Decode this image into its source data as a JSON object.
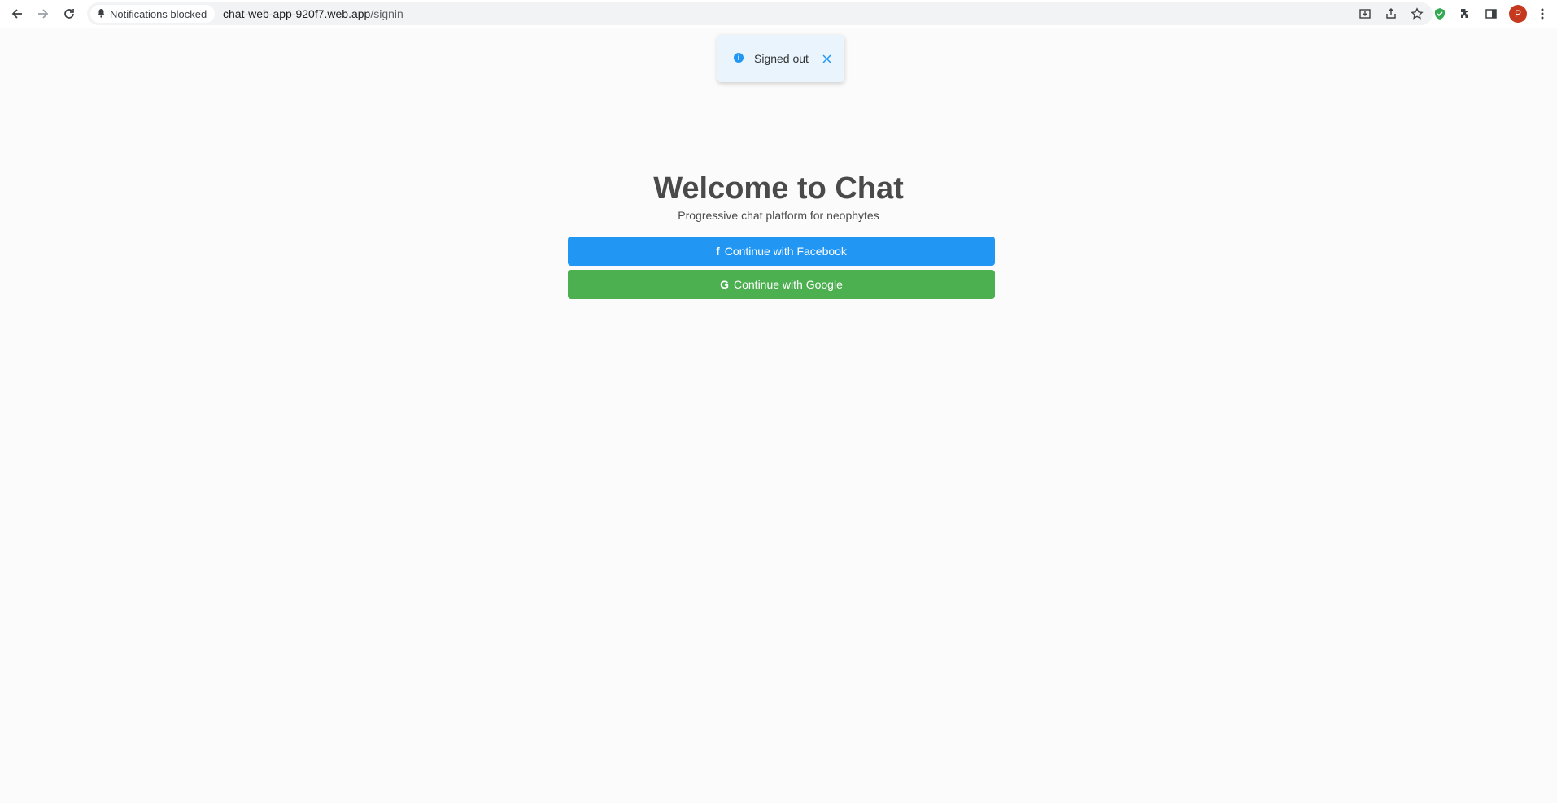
{
  "browser": {
    "notification_chip": "Notifications blocked",
    "url_host": "chat-web-app-920f7.web.app",
    "url_path": "/signin",
    "profile_initial": "P"
  },
  "toast": {
    "message": "Signed out"
  },
  "main": {
    "title": "Welcome to Chat",
    "subtitle": "Progressive chat platform for neophytes",
    "facebook_button": "Continue with Facebook",
    "google_button": "Continue with Google",
    "facebook_glyph": "f",
    "google_glyph": "G"
  },
  "colors": {
    "facebook": "#2196f3",
    "google": "#4caf50",
    "toast_bg": "#e9f4fd",
    "avatar": "#c5391f"
  },
  "icons": {
    "back": "back-arrow-icon",
    "forward": "forward-arrow-icon",
    "reload": "reload-icon",
    "bell": "bell-icon",
    "install": "install-icon",
    "share": "share-icon",
    "bookmark": "star-icon",
    "extension_shield": "shield-icon",
    "extensions": "puzzle-icon",
    "side_panel": "side-panel-icon",
    "menu": "kebab-menu-icon",
    "toast_info": "info-icon",
    "toast_close": "close-icon"
  }
}
